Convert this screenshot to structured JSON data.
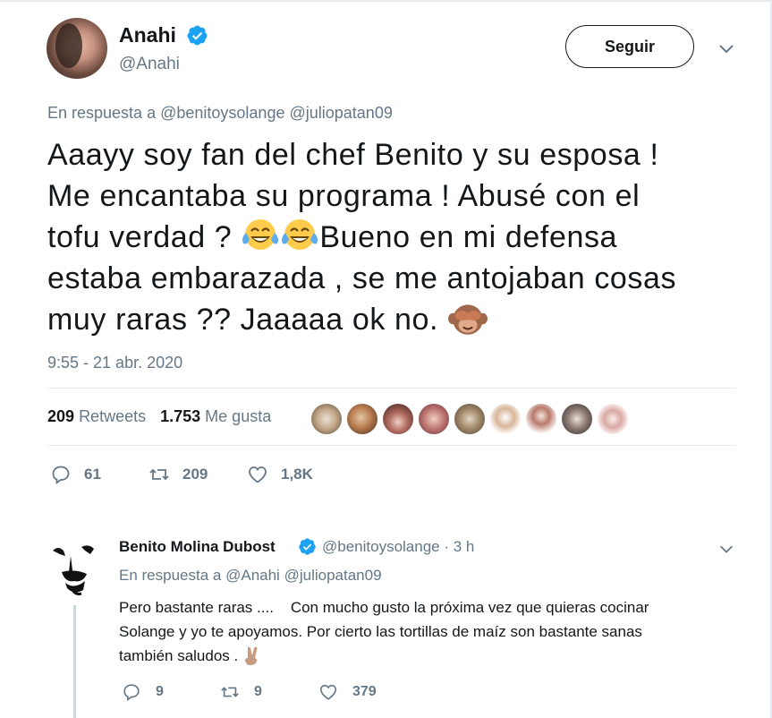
{
  "main_tweet": {
    "author_name": "Anahi",
    "author_handle": "@Anahi",
    "follow_label": "Seguir",
    "reply_prefix": "En respuesta a",
    "reply_mentions": [
      "@benitoysolange",
      "@juliopatan09"
    ],
    "text_lines": [
      "Aaayy soy fan del chef Benito y su esposa !",
      "Me encantaba su programa ! Abusé con el",
      "tofu verdad ? ",
      "Bueno en mi defensa",
      "estaba embarazada , se me antojaban cosas",
      "muy raras ?? Jaaaaa ok no. "
    ],
    "timestamp": "9:55 - 21 abr. 2020",
    "retweets_count": "209",
    "retweets_label": "Retweets",
    "likes_count": "1.753",
    "likes_label": "Me gusta",
    "actions": {
      "replies": "61",
      "retweets": "209",
      "likes": "1,8K"
    }
  },
  "reply_tweet": {
    "author_name": "Benito Molina Dubost",
    "author_handle": "@benitoysolange · 3 h",
    "reply_prefix": "En respuesta a",
    "reply_mentions": [
      "@Anahi",
      "@juliopatan09"
    ],
    "text_lines": [
      "Pero bastante raras ....    Con mucho gusto la próxima vez que quieras cocinar",
      "Solange y yo te apoyamos. Por cierto las tortillas de maíz son bastante sanas",
      "también saludos . "
    ],
    "actions": {
      "replies": "9",
      "retweets": "9",
      "likes": "379"
    }
  },
  "colors": {
    "text": "#14171a",
    "secondary": "#657786",
    "link": "#1b95e0",
    "verified": "#1da1f2"
  },
  "icons": [
    "verified-badge-icon",
    "chevron-down-icon",
    "reply-icon",
    "retweet-icon",
    "heart-icon",
    "tears-of-joy-emoji",
    "see-no-evil-monkey-emoji",
    "victory-hand-emoji"
  ]
}
